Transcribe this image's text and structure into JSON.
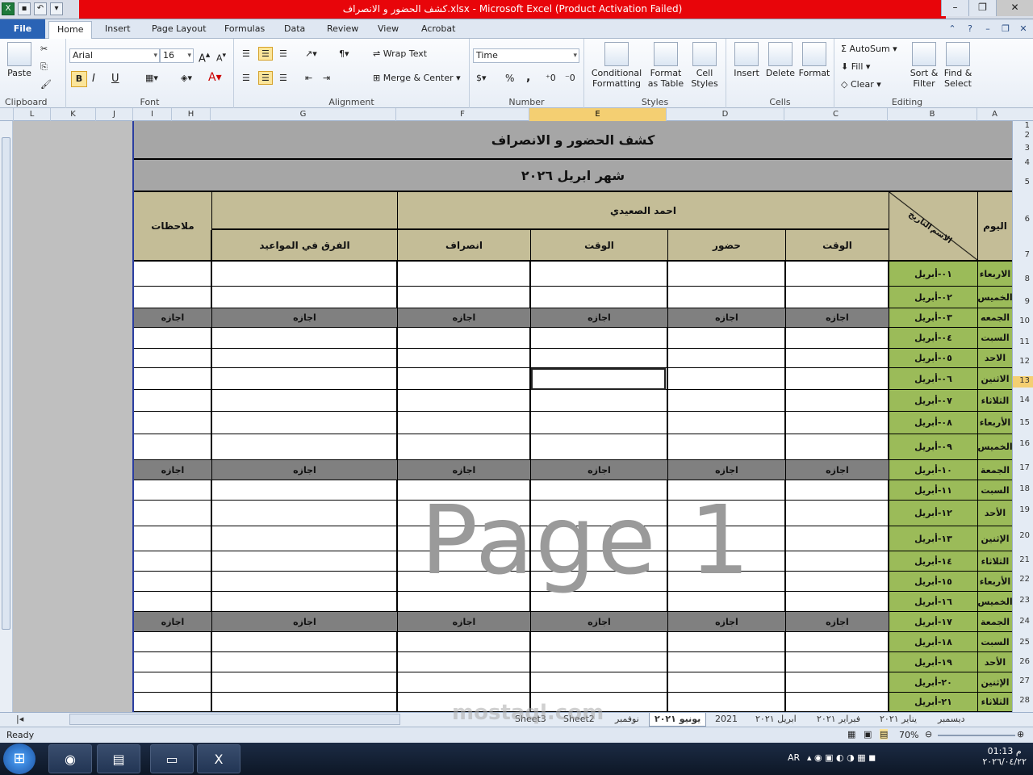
{
  "window": {
    "title": "كشف الحضور و الانصراف.xlsx  -  Microsoft Excel (Product Activation Failed)"
  },
  "tabs": [
    "File",
    "Home",
    "Insert",
    "Page Layout",
    "Formulas",
    "Data",
    "Review",
    "View",
    "Acrobat"
  ],
  "ribbon": {
    "clipboard": {
      "label": "Clipboard",
      "paste": "Paste"
    },
    "font": {
      "label": "Font",
      "name": "Arial",
      "size": "16",
      "bold": "B",
      "italic": "I",
      "underline": "U"
    },
    "alignment": {
      "label": "Alignment",
      "wrap": "Wrap Text",
      "merge": "Merge & Center"
    },
    "number": {
      "label": "Number",
      "format": "Time",
      "percent": "%",
      "comma": ","
    },
    "styles": {
      "label": "Styles",
      "cond": "Conditional Formatting",
      "table": "Format as Table",
      "cell": "Cell Styles"
    },
    "cells": {
      "label": "Cells",
      "insert": "Insert",
      "delete": "Delete",
      "format": "Format"
    },
    "editing": {
      "label": "Editing",
      "autosum": "AutoSum",
      "fill": "Fill",
      "clear": "Clear",
      "sort": "Sort & Filter",
      "find": "Find & Select"
    }
  },
  "columns": [
    "L",
    "K",
    "J",
    "I",
    "H",
    "G",
    "F",
    "E",
    "D",
    "C",
    "B",
    "A"
  ],
  "rows": [
    "1",
    "2",
    "3",
    "4",
    "5",
    "6",
    "7",
    "8",
    "9",
    "10",
    "11",
    "12",
    "13",
    "14",
    "15",
    "16",
    "17",
    "18",
    "19",
    "20",
    "21",
    "22",
    "23",
    "24",
    "25",
    "26",
    "27",
    "28"
  ],
  "sheet": {
    "title": "كشف الحضور و الانصراف",
    "month": "شهر     ابريل ٢٠٢٦",
    "name": "احمد الصعيدي",
    "headers": {
      "day": "اليوم",
      "diag_top": "التاريخ",
      "diag_bottom": "الاسم",
      "time1": "الوقت",
      "attend": "حضور",
      "time2": "الوقت",
      "leave": "انصراف",
      "diff": "الفرق في المواعيد",
      "notes": "ملاحظات"
    },
    "holiday": "اجازه",
    "days": [
      {
        "day": "الاربعاء",
        "date": "٠١-أبريل",
        "holiday": false
      },
      {
        "day": "الخميس",
        "date": "٠٢-أبريل",
        "holiday": false
      },
      {
        "day": "الجمعه",
        "date": "٠٣-أبريل",
        "holiday": true
      },
      {
        "day": "السبت",
        "date": "٠٤-أبريل",
        "holiday": false
      },
      {
        "day": "الاحد",
        "date": "٠٥-أبريل",
        "holiday": false
      },
      {
        "day": "الاثنين",
        "date": "٠٦-أبريل",
        "holiday": false
      },
      {
        "day": "الثلاثاء",
        "date": "٠٧-أبريل",
        "holiday": false
      },
      {
        "day": "الأربعاء",
        "date": "٠٨-أبريل",
        "holiday": false
      },
      {
        "day": "الخميس",
        "date": "٠٩-أبريل",
        "holiday": false
      },
      {
        "day": "الجمعة",
        "date": "١٠-أبريل",
        "holiday": true
      },
      {
        "day": "السبت",
        "date": "١١-أبريل",
        "holiday": false
      },
      {
        "day": "الأحد",
        "date": "١٢-أبريل",
        "holiday": false
      },
      {
        "day": "الإثنين",
        "date": "١٣-أبريل",
        "holiday": false
      },
      {
        "day": "الثلاثاء",
        "date": "١٤-أبريل",
        "holiday": false
      },
      {
        "day": "الأربعاء",
        "date": "١٥-أبريل",
        "holiday": false
      },
      {
        "day": "الخميس",
        "date": "١٦-أبريل",
        "holiday": false
      },
      {
        "day": "الجمعة",
        "date": "١٧-أبريل",
        "holiday": true
      },
      {
        "day": "السبت",
        "date": "١٨-أبريل",
        "holiday": false
      },
      {
        "day": "الأحد",
        "date": "١٩-أبريل",
        "holiday": false
      },
      {
        "day": "الإثنين",
        "date": "٢٠-أبريل",
        "holiday": false
      },
      {
        "day": "الثلاثاء",
        "date": "٢١-أبريل",
        "holiday": false
      }
    ],
    "watermark": "Page 1"
  },
  "sheet_tabs": [
    "Sheet3",
    "Sheet2",
    "نوفمبر",
    "يونيو ٢٠٢١",
    "2021",
    "ابريل ٢٠٢١",
    "فبراير ٢٠٢١",
    "يناير ٢٠٢١",
    "ديسمبر"
  ],
  "active_tab": "يونيو ٢٠٢١",
  "status": {
    "ready": "Ready",
    "zoom": "70%"
  },
  "taskbar": {
    "lang": "AR",
    "time": "01:13 م",
    "date": "٢٠٢٦/٠٤/٢٢"
  },
  "watermark2": "mostaql.com"
}
